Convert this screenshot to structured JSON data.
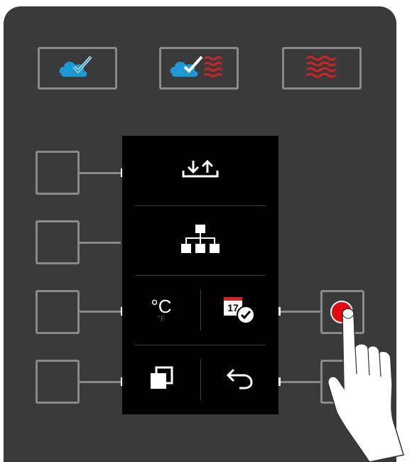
{
  "panel": {
    "background": "#3a3a3a",
    "button_border": "#8a8a8a",
    "steam_color": "#1b9ad6",
    "heat_color": "#d82027",
    "press_color": "#e30613"
  },
  "mode_buttons": [
    {
      "name": "steam-mode-button",
      "icon": "steam-icon"
    },
    {
      "name": "combi-mode-button",
      "icon": "steam-and-heat-icon"
    },
    {
      "name": "convection-mode-button",
      "icon": "heat-waves-icon"
    }
  ],
  "screen": {
    "rows": [
      {
        "icons": [
          "data-transfer-icon"
        ]
      },
      {
        "icons": [
          "network-hierarchy-icon"
        ]
      },
      {
        "icons": [
          "temperature-unit-icon",
          "calendar-check-icon"
        ]
      },
      {
        "icons": [
          "copy-icon",
          "back-arrow-icon"
        ]
      }
    ],
    "temperature_unit": {
      "primary": "°C",
      "secondary": "°F"
    },
    "calendar_day": "17"
  },
  "pressed_button": "right-side-button-3"
}
